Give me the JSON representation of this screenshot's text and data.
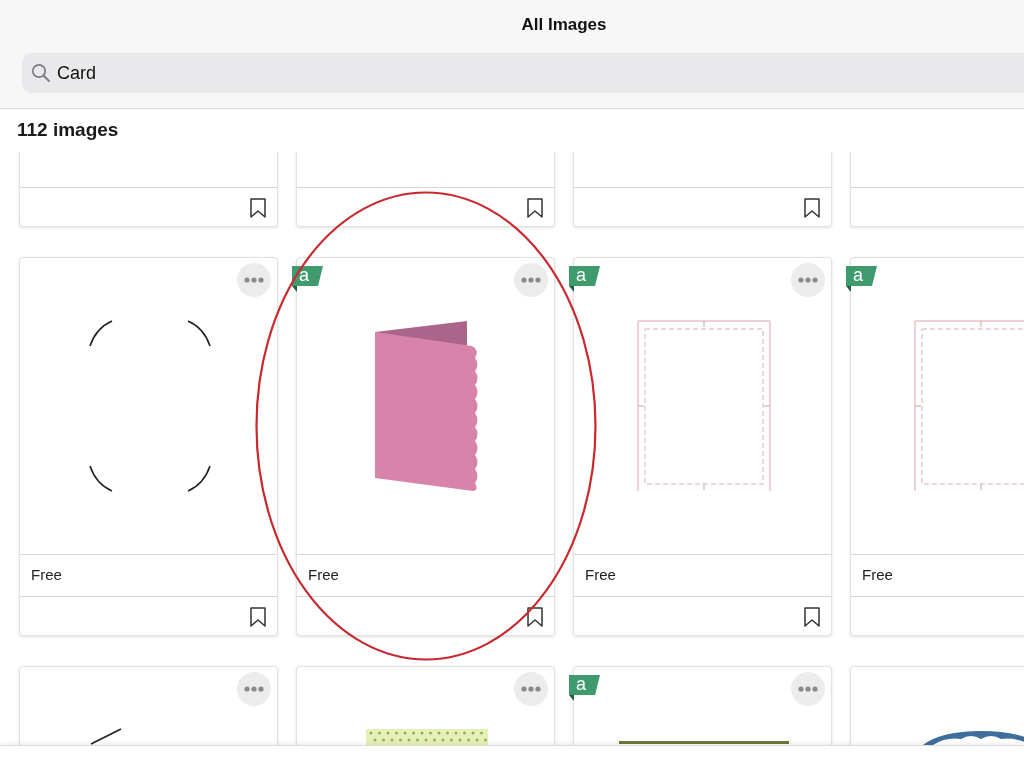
{
  "header": {
    "title": "All Images"
  },
  "search": {
    "value": "Card"
  },
  "result_count": "112 images",
  "rows": [
    [
      {
        "bookmark": true
      },
      {
        "bookmark": true
      },
      {
        "bookmark": true
      },
      {}
    ],
    [
      {
        "kind": "corners",
        "label": "Free",
        "menu": true,
        "bookmark": true
      },
      {
        "kind": "folded",
        "badge": "a",
        "label": "Free",
        "menu": true,
        "bookmark": true
      },
      {
        "kind": "frame",
        "badge": "a",
        "label": "Free",
        "menu": true,
        "bookmark": true
      },
      {
        "kind": "frame",
        "badge": "a",
        "label": "Free"
      }
    ],
    [
      {
        "kind": "slash",
        "menu": true
      },
      {
        "kind": "strip",
        "menu": true
      },
      {
        "kind": "line",
        "badge": "a",
        "menu": true
      },
      {
        "kind": "ornament"
      }
    ]
  ]
}
